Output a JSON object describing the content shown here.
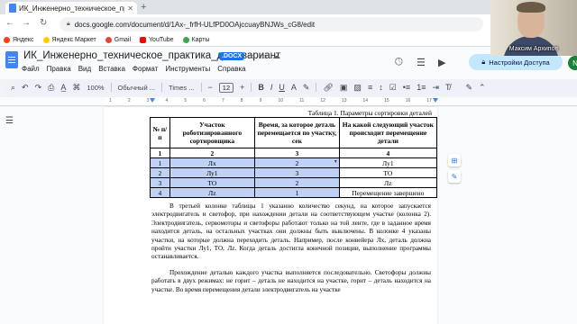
{
  "browser": {
    "tab_title": "ИК_Инженерно_техническое_практ",
    "url": "docs.google.com/document/d/1Ax-_frfH-ULfPD0OAjccuayBNJWs_cG8/edit",
    "bookmarks": [
      "Яндекс",
      "Яндекс Маркет",
      "Gmail",
      "YouTube",
      "Карты"
    ]
  },
  "docs": {
    "title": "ИК_Инженерно_техническое_практика_демовариант",
    "badge": ".DOCX",
    "menu": [
      "Файл",
      "Правка",
      "Вид",
      "Вставка",
      "Формат",
      "Инструменты",
      "Справка"
    ],
    "share_label": "Настройки Доступа",
    "avatar_letter": "N"
  },
  "toolbar": {
    "zoom": "100%",
    "style": "Обычный ...",
    "font": "Times ...",
    "font_size": "12"
  },
  "ruler": {
    "numbers": [
      "1",
      "2",
      "3",
      "4",
      "5",
      "6",
      "7",
      "8",
      "9",
      "10",
      "11",
      "12",
      "13",
      "14",
      "15",
      "16",
      "17"
    ]
  },
  "document": {
    "caption": "Таблица 1. Параметры сортировки деталей",
    "table": {
      "headers": [
        "№ п/п",
        "Участок роботизированного сортировщика",
        "Время, за которое деталь перемещается по участку, сек",
        "На какой следующий участок происходит перемещение детали"
      ],
      "numbers": [
        "1",
        "2",
        "3",
        "4"
      ],
      "rows": [
        [
          "1",
          "Лх",
          "2",
          "Лу1"
        ],
        [
          "2",
          "Лу1",
          "3",
          "ТО"
        ],
        [
          "3",
          "ТО",
          "2",
          "Лz"
        ],
        [
          "4",
          "Лz",
          "1",
          "Перемещение завершено"
        ]
      ]
    },
    "paragraph1": "В третьей колонке таблицы 1 указанно количество секунд, на которое запускается электродвигатель и светофор, при нахождении детали на соответствующем участке (колонка 2). Электродвигатель, сервомоторы и светофоры работают только на той ленте, где в заданное время находится деталь, на остальных участках они должны быть выключены. В колонке 4 указаны участки, на которые должна переходить деталь. Например, после конвейера Лх, деталь должна пройти участки Лу1, ТО, Лz. Когда деталь достигла конечной позиции, выполнение программы останавливается.",
    "paragraph2": "Прохождение деталью каждого участка выполняется последовательно. Светофоры должны работать в двух режимах: не горит – деталь не находится на участке, горит – деталь находится на участке. Во время перемещения детали электродвигатель на участке"
  },
  "video": {
    "name": "Максим Архипов"
  },
  "colors": {
    "accent": "#1a73e8",
    "share_bg": "#c2e7ff",
    "highlight": "#bfd2f5"
  }
}
